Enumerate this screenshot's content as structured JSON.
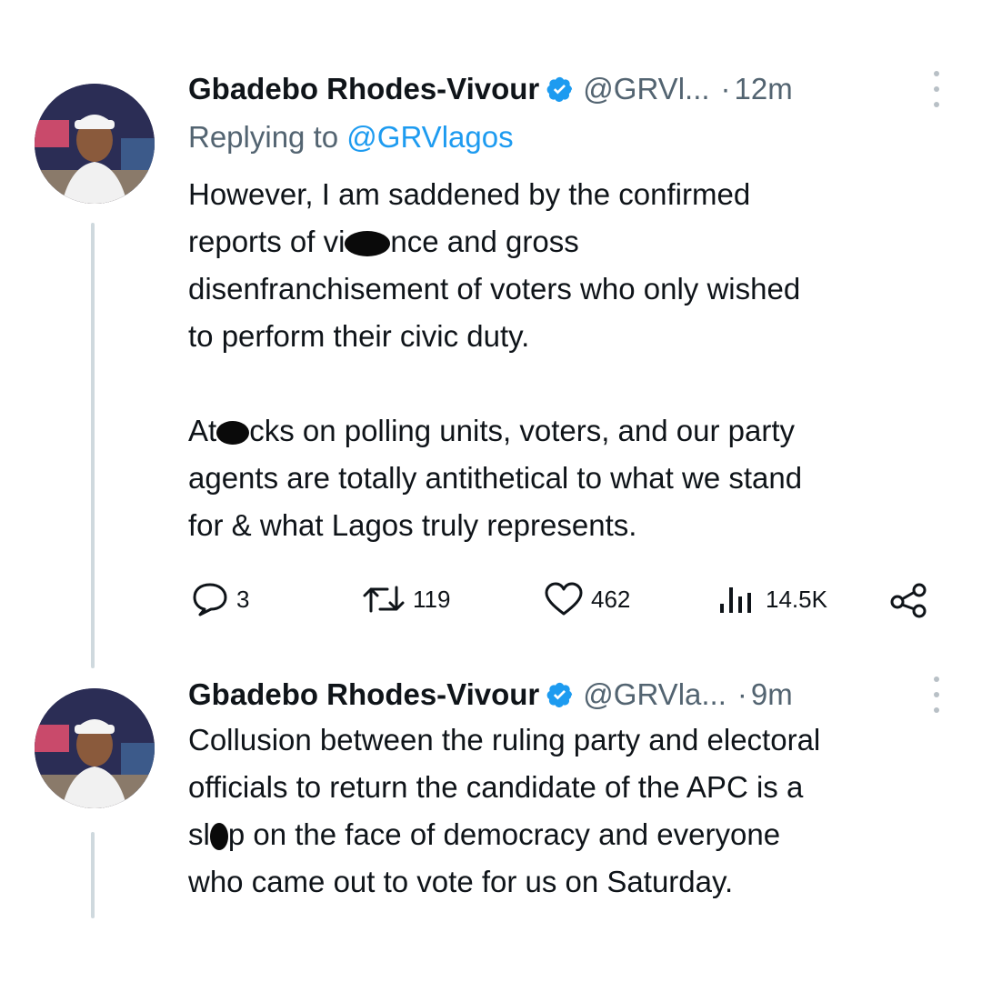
{
  "tweets": [
    {
      "author_name": "Gbadebo Rhodes-Vivour",
      "handle": "@GRVl...",
      "dot": "·",
      "time": "12m",
      "replying_prefix": "Replying to",
      "replying_to": "@GRVlagos",
      "p1_a": "However, I am saddened by the confirmed",
      "p1_b_pre": "reports of vi",
      "p1_b_post": "nce and gross",
      "p1_c": "disenfranchisement of voters who only wished",
      "p1_d": "to perform their civic duty.",
      "p2_a_pre": "At",
      "p2_a_post": "cks on polling units, voters, and our party",
      "p2_b": "agents are totally antithetical to what we stand",
      "p2_c": "for & what Lagos truly represents."
    },
    {
      "author_name": "Gbadebo Rhodes-Vivour",
      "handle": "@GRVla...",
      "dot": "·",
      "time": "9m",
      "line_a": "Collusion between the ruling party and electoral",
      "line_b": "officials to return the candidate of the APC is a",
      "line_c_pre": "sl",
      "line_c_post": "p on the face of democracy and everyone",
      "line_d": "who came out to vote for us on Saturday."
    }
  ],
  "actions": {
    "replies": "3",
    "retweets": "119",
    "likes": "462",
    "views": "14.5K"
  },
  "icons": {
    "verified": "verified-badge-icon",
    "more": "more-options-icon",
    "reply": "reply-icon",
    "retweet": "retweet-icon",
    "like": "heart-icon",
    "views": "views-icon",
    "share": "share-icon"
  },
  "colors": {
    "accent": "#1d9bf0",
    "secondary_text": "#536471",
    "thread_line": "#cfd9de"
  }
}
